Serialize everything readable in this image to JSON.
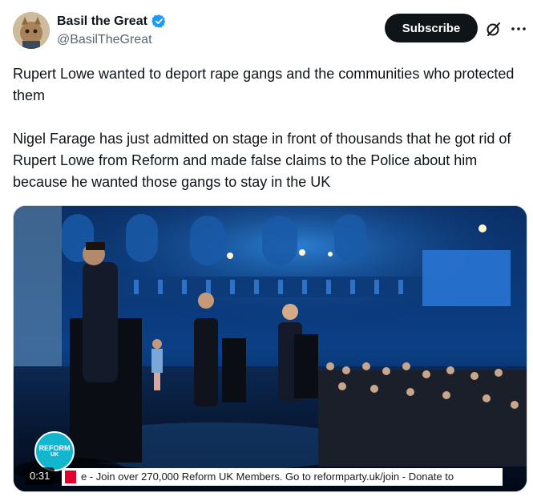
{
  "author": {
    "display_name": "Basil the Great",
    "handle": "@BasilTheGreat",
    "verified": true
  },
  "header": {
    "subscribe_label": "Subscribe",
    "grok_icon": "grok-icon",
    "more_icon": "more-icon"
  },
  "tweet": {
    "paragraphs": [
      "Rupert Lowe wanted to deport rape gangs and the communities who protected them",
      "Nigel Farage has just admitted on stage in front of thousands that he got rid of Rupert Lowe from Reform and made false claims to the Police about him because he wanted those gangs to stay in the UK"
    ]
  },
  "media": {
    "type": "video",
    "duration": "0:31",
    "ticker_text": "e   -   Join over 270,000 Reform UK Members. Go to reformparty.uk/join   -   Donate to",
    "logo_line1": "REFORM",
    "logo_line2": "UK"
  },
  "colors": {
    "text_primary": "#0f1419",
    "text_secondary": "#536471",
    "verified_blue": "#1d9bf0",
    "subscribe_bg": "#0f1419",
    "reform_teal": "#12b6cf"
  }
}
